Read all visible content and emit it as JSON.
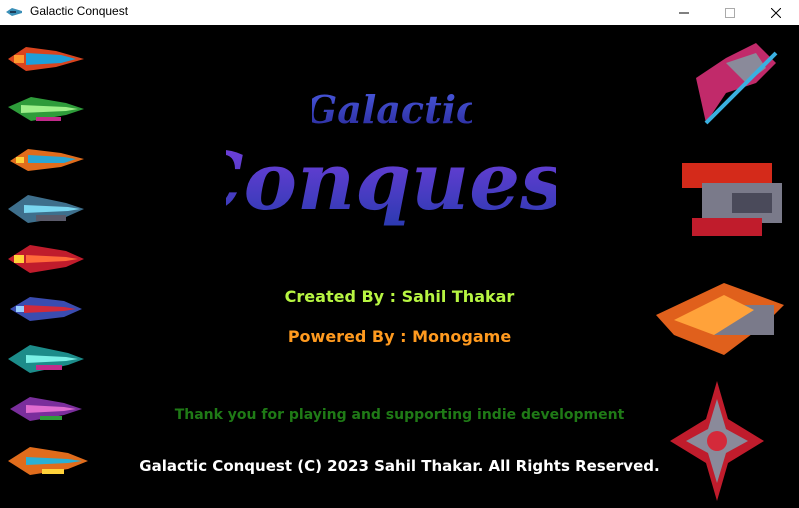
{
  "window": {
    "title": "Galactic Conquest",
    "controls": [
      "minimize",
      "maximize",
      "close"
    ]
  },
  "game": {
    "logo_line1": "Galactic",
    "logo_line2": "Conquest",
    "created_by": "Created By : Sahil Thakar",
    "powered_by": "Powered By : Monogame",
    "thanks": "Thank you for playing and supporting indie development",
    "copyright": "Galactic Conquest (C) 2023 Sahil Thakar. All Rights Reserved."
  },
  "colors": {
    "created_by": "#b7f542",
    "powered_by": "#ff9a1f",
    "thanks": "#1f7a16",
    "copyright": "#ffffff",
    "logo_top": "#3b4cc0",
    "logo_bottom": "#6a3fd6"
  }
}
